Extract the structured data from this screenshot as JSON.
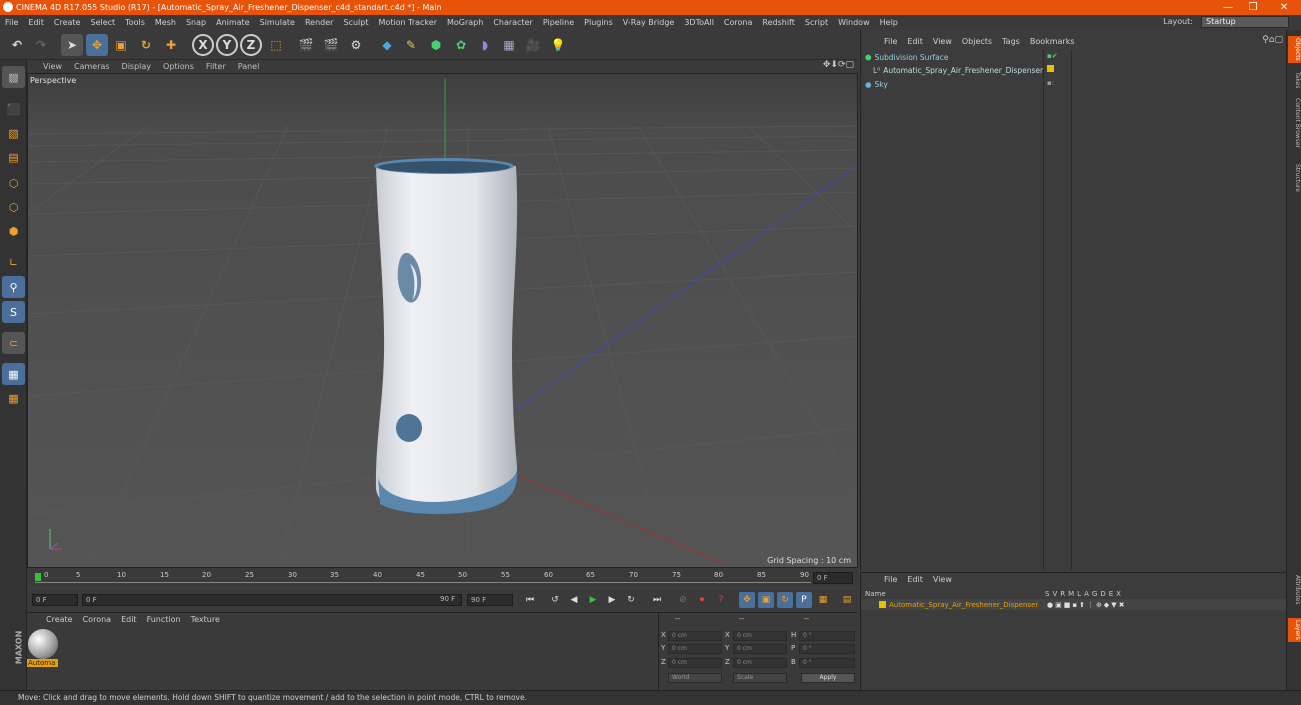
{
  "window": {
    "title": "CINEMA 4D R17.055 Studio (R17) - [Automatic_Spray_Air_Freshener_Dispenser_c4d_standart.c4d *] - Main",
    "minimize": "—",
    "restore": "❐",
    "close": "✕"
  },
  "menubar": {
    "items": [
      "File",
      "Edit",
      "Create",
      "Select",
      "Tools",
      "Mesh",
      "Snap",
      "Animate",
      "Simulate",
      "Render",
      "Sculpt",
      "Motion Tracker",
      "MoGraph",
      "Character",
      "Pipeline",
      "Plugins",
      "V-Ray Bridge",
      "3DToAll",
      "Corona",
      "Redshift",
      "Script",
      "Window",
      "Help"
    ],
    "layout_label": "Layout:",
    "layout_value": "Startup"
  },
  "viewport": {
    "menu": [
      "View",
      "Cameras",
      "Display",
      "Options",
      "Filter",
      "Panel"
    ],
    "label": "Perspective",
    "grid_spacing": "Grid Spacing : 10 cm"
  },
  "timeline": {
    "ticks": [
      "0",
      "5",
      "10",
      "15",
      "20",
      "25",
      "30",
      "35",
      "40",
      "45",
      "50",
      "55",
      "60",
      "65",
      "70",
      "75",
      "80",
      "85",
      "90"
    ],
    "current_frame": "0 F"
  },
  "transport": {
    "start": "0 F",
    "slider_start": "0 F",
    "slider_end": "90 F",
    "end": "90 F"
  },
  "materials": {
    "menu": [
      "Create",
      "Corona",
      "Edit",
      "Function",
      "Texture"
    ],
    "item_label": "Automa"
  },
  "coordinates": {
    "headers": [
      "--",
      "--",
      "--"
    ],
    "rows": [
      {
        "a": "X",
        "av": "0 cm",
        "b": "X",
        "bv": "0 cm",
        "c": "H",
        "cv": "0 °"
      },
      {
        "a": "Y",
        "av": "0 cm",
        "b": "Y",
        "bv": "0 cm",
        "c": "P",
        "cv": "0 °"
      },
      {
        "a": "Z",
        "av": "0 cm",
        "b": "Z",
        "bv": "0 cm",
        "c": "B",
        "cv": "0 °"
      }
    ],
    "world": "World",
    "scale": "Scale",
    "apply": "Apply"
  },
  "objects": {
    "menu": [
      "File",
      "Edit",
      "View",
      "Objects",
      "Tags",
      "Bookmarks"
    ],
    "items": [
      {
        "name": "Subdivision Surface"
      },
      {
        "name": "Automatic_Spray_Air_Freshener_Dispenser"
      },
      {
        "name": "Sky"
      }
    ]
  },
  "layers": {
    "menu": [
      "File",
      "Edit",
      "View"
    ],
    "columns": {
      "name": "Name",
      "flags": [
        "S",
        "V",
        "R",
        "M",
        "L",
        "A",
        "G",
        "D",
        "E",
        "X"
      ]
    },
    "item": "Automatic_Spray_Air_Freshener_Dispenser"
  },
  "right_tabs": [
    "Objects",
    "Takes",
    "Content Browser",
    "Structure"
  ],
  "right_tabs_bottom": [
    "Attributes",
    "Layers"
  ],
  "status": "Move: Click and drag to move elements. Hold down SHIFT to quantize movement / add to the selection in point mode, CTRL to remove.",
  "colors": {
    "accent": "#e8530a",
    "object_blue": "#5a87ad",
    "layer_name": "#e8a000"
  }
}
